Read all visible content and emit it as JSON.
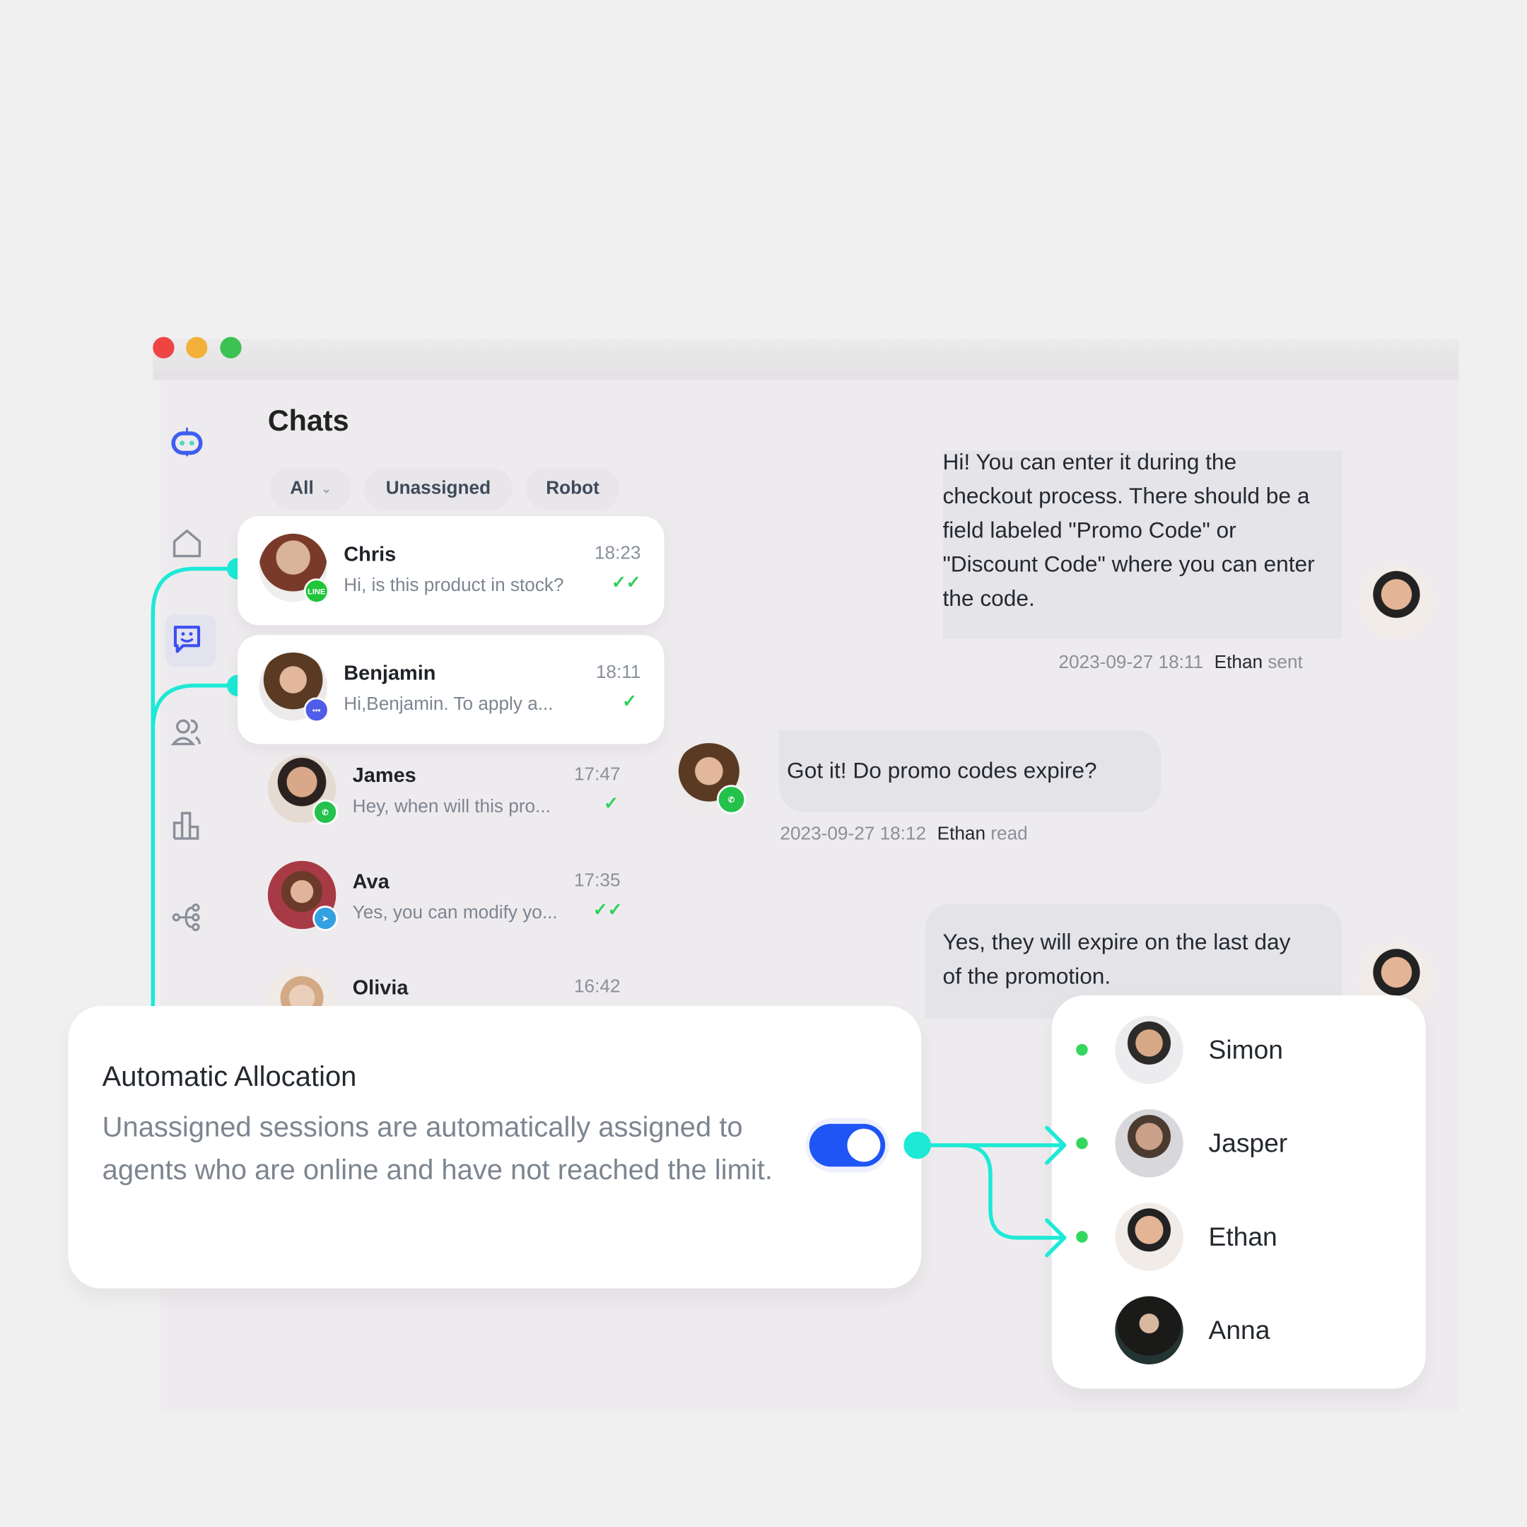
{
  "window": {
    "controls": [
      {
        "name": "close",
        "color": "#ef4444"
      },
      {
        "name": "minimize",
        "color": "#f2b23a"
      },
      {
        "name": "maximize",
        "color": "#3cc153"
      }
    ]
  },
  "sidebar": {
    "logo": "robot-icon",
    "items": [
      {
        "icon": "home-icon",
        "active": false
      },
      {
        "icon": "chat-smile-icon",
        "active": true
      },
      {
        "icon": "users-icon",
        "active": false
      },
      {
        "icon": "bar-chart-icon",
        "active": false
      },
      {
        "icon": "flow-icon",
        "active": false
      }
    ]
  },
  "chats": {
    "title": "Chats",
    "tabs": [
      {
        "label": "All",
        "has_dropdown": true
      },
      {
        "label": "Unassigned"
      },
      {
        "label": "Robot"
      }
    ],
    "list": [
      {
        "name": "Chris",
        "time": "18:23",
        "preview": "Hi, is this product in stock?",
        "channel": "LINE",
        "status": "read",
        "highlighted": true
      },
      {
        "name": "Benjamin",
        "time": "18:11",
        "preview": "Hi,Benjamin. To apply a...",
        "channel": "chat",
        "status": "sent",
        "highlighted": true
      },
      {
        "name": "James",
        "time": "17:47",
        "preview": "Hey, when will this pro...",
        "channel": "WhatsApp",
        "status": "sent",
        "highlighted": false
      },
      {
        "name": "Ava",
        "time": "17:35",
        "preview": "Yes, you can modify yo...",
        "channel": "Telegram",
        "status": "read",
        "highlighted": false
      },
      {
        "name": "Olivia",
        "time": "16:42",
        "preview": "",
        "channel": "",
        "status": "",
        "highlighted": false
      }
    ]
  },
  "conversation": {
    "messages": [
      {
        "from": "agent",
        "text": "Hi! You can enter it during the checkout process. There should be a field labeled \"Promo Code\" or \"Discount Code\" where you can enter the code.",
        "timestamp": "2023-09-27 18:11",
        "actor": "Ethan",
        "status": "sent"
      },
      {
        "from": "customer",
        "text": "Got it! Do promo codes expire?",
        "timestamp": "2023-09-27 18:12",
        "actor": "Ethan",
        "status": "read",
        "channel": "WhatsApp"
      },
      {
        "from": "agent",
        "text": "Yes, they will expire on the last day of the promotion.",
        "timestamp": "",
        "actor": "",
        "status": ""
      }
    ]
  },
  "allocation": {
    "title": "Automatic Allocation",
    "description": "Unassigned sessions are automatically assigned to agents who are online and have not reached the limit.",
    "enabled": true
  },
  "agents": [
    {
      "name": "Simon",
      "online": true,
      "assigned": false
    },
    {
      "name": "Jasper",
      "online": true,
      "assigned": true
    },
    {
      "name": "Ethan",
      "online": true,
      "assigned": true
    },
    {
      "name": "Anna",
      "online": false,
      "assigned": false
    }
  ],
  "colors": {
    "accent": "#1f55f5",
    "connector": "#1de9d6",
    "online": "#35d65e",
    "read_tick": "#2ed158"
  }
}
